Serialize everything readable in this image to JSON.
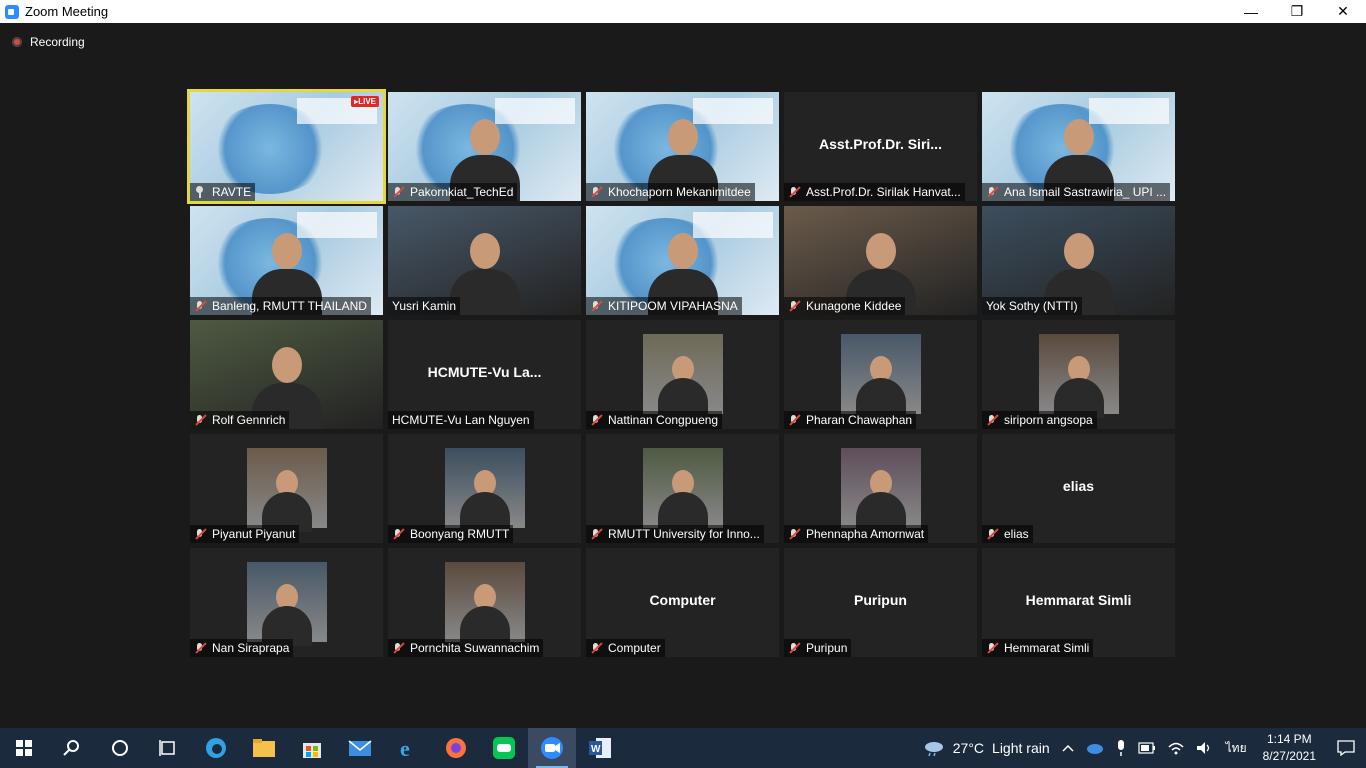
{
  "window": {
    "title": "Zoom Meeting",
    "minimize": "—",
    "maximize": "❐",
    "close": "✕"
  },
  "recording": {
    "label": "Recording"
  },
  "tiles": [
    {
      "name": "RAVTE",
      "type": "slide",
      "live": "LIVE",
      "pinned": true
    },
    {
      "name": "Pakornkiat_TechEd",
      "type": "video"
    },
    {
      "name": "Khochaporn Mekanimitdee",
      "type": "video"
    },
    {
      "name": "Asst.Prof.Dr. Sirilak Hanvat...",
      "type": "text",
      "display": "Asst.Prof.Dr.  Siri..."
    },
    {
      "name": "Ana Ismail Sastrawiria_ UPI ...",
      "type": "video"
    },
    {
      "name": "Banleng, RMUTT THAILAND",
      "type": "video"
    },
    {
      "name": "Yusri Kamin",
      "type": "video",
      "unmuted": true
    },
    {
      "name": "KITIPOOM VIPAHASNA",
      "type": "video"
    },
    {
      "name": "Kunagone Kiddee",
      "type": "video"
    },
    {
      "name": "Yok Sothy (NTTI)",
      "type": "video",
      "unmuted": true
    },
    {
      "name": "Rolf Gennrich",
      "type": "video"
    },
    {
      "name": "HCMUTE-Vu Lan Nguyen",
      "type": "text",
      "display": "HCMUTE-Vu  La...",
      "unmuted": true
    },
    {
      "name": "Nattinan Congpueng",
      "type": "photo"
    },
    {
      "name": "Pharan Chawaphan",
      "type": "photo"
    },
    {
      "name": "siriporn angsopa",
      "type": "photo"
    },
    {
      "name": "Piyanut Piyanut",
      "type": "photo"
    },
    {
      "name": "Boonyang RMUTT",
      "type": "photo"
    },
    {
      "name": "RMUTT University for Inno...",
      "type": "photo"
    },
    {
      "name": "Phennapha Amornwat",
      "type": "photo"
    },
    {
      "name": "elias",
      "type": "text",
      "display": "elias"
    },
    {
      "name": "Nan Siraprapa",
      "type": "photo"
    },
    {
      "name": "Pornchita Suwannachim",
      "type": "photo"
    },
    {
      "name": "Computer",
      "type": "text",
      "display": "Computer"
    },
    {
      "name": "Puripun",
      "type": "text",
      "display": "Puripun"
    },
    {
      "name": "Hemmarat Simli",
      "type": "text",
      "display": "Hemmarat Simli"
    }
  ],
  "taskbar": {
    "weather": {
      "temp": "27°C",
      "condition": "Light rain"
    },
    "lang": "ไทย",
    "time": "1:14 PM",
    "date": "8/27/2021"
  },
  "colors": {
    "active_speaker": "#e4d93c",
    "mute": "#e0463e",
    "taskbar": "#1c2a3e"
  }
}
